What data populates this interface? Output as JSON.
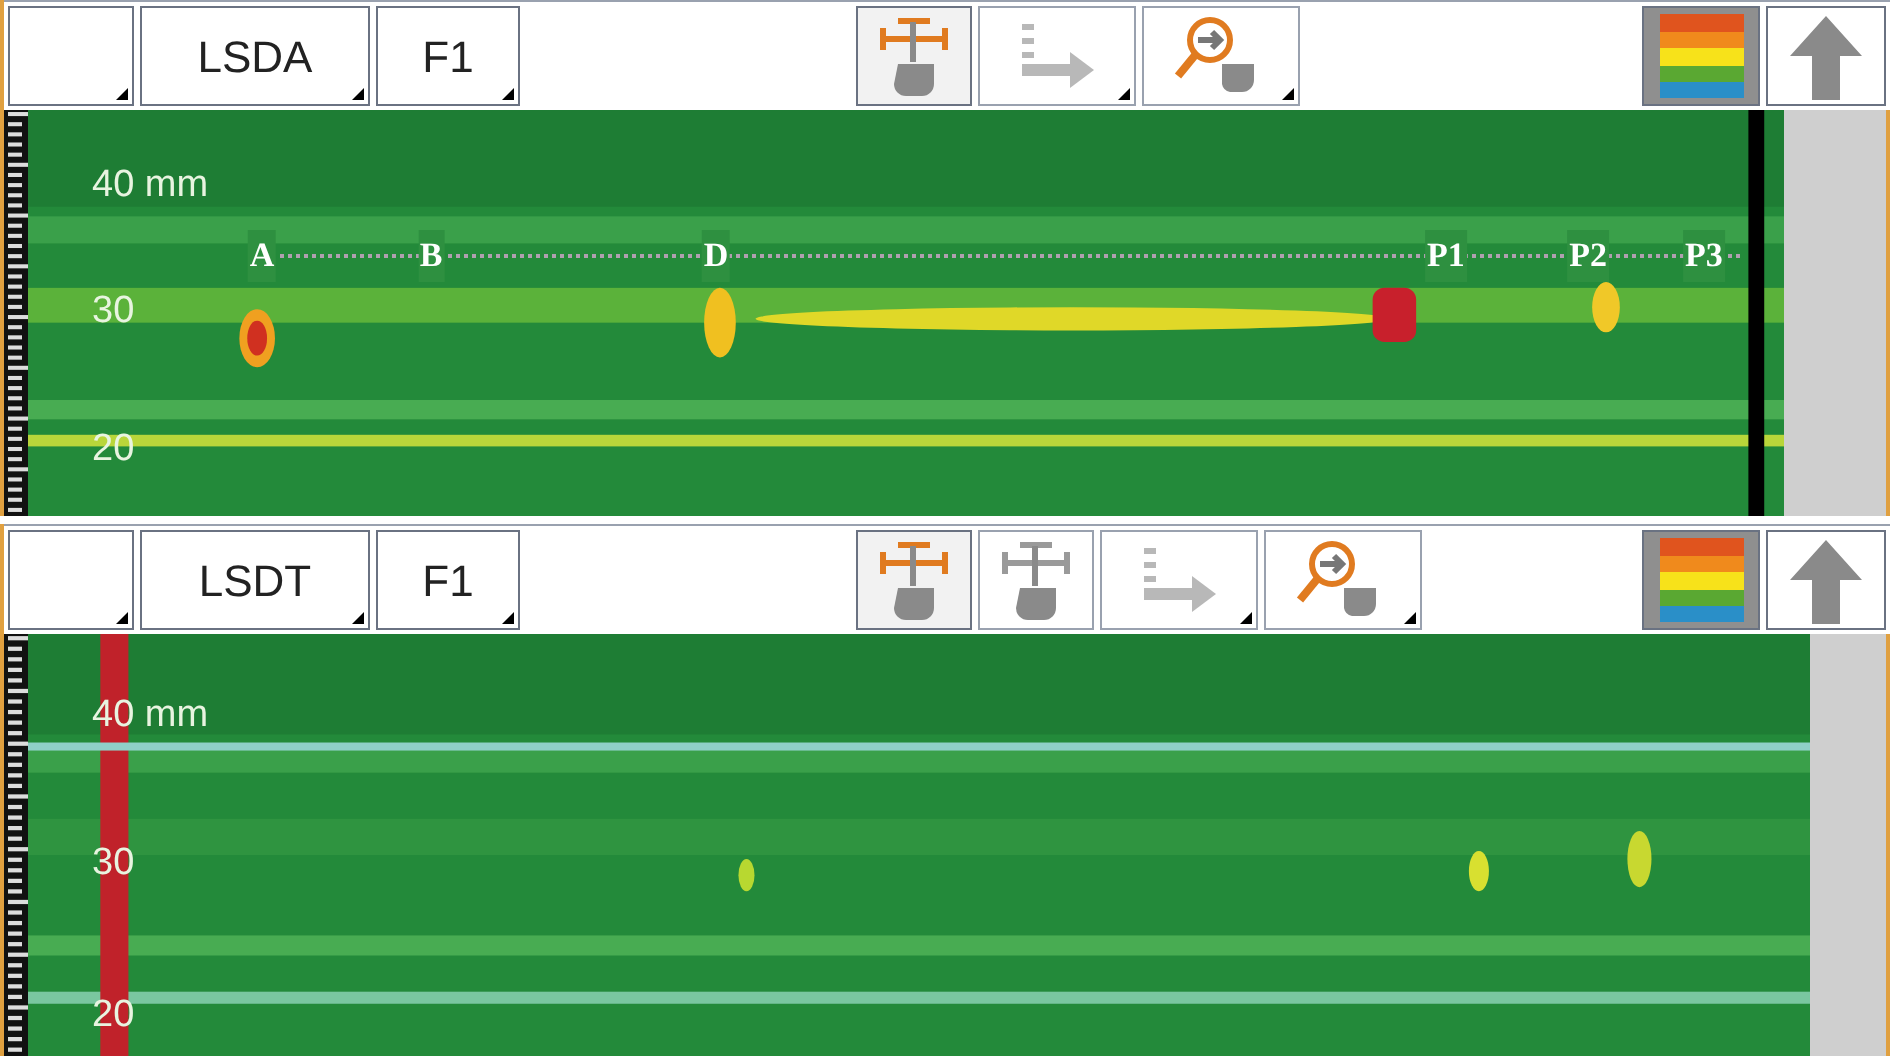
{
  "panels": [
    {
      "toolbar": {
        "channel": "LSDA",
        "filter": "F1",
        "tools": [
          {
            "kind": "gate",
            "active": true
          },
          {
            "kind": "axis",
            "active": false
          },
          {
            "kind": "zoom",
            "active": false
          }
        ]
      },
      "scale": [
        "40 mm",
        "30",
        "20"
      ],
      "markers": [
        "A",
        "B",
        "D",
        "P1",
        "P2",
        "P3"
      ]
    },
    {
      "toolbar": {
        "channel": "LSDT",
        "filter": "F1",
        "tools": [
          {
            "kind": "gate",
            "active": true
          },
          {
            "kind": "gate",
            "active": false
          },
          {
            "kind": "axis",
            "active": false
          },
          {
            "kind": "zoom",
            "active": false
          }
        ]
      },
      "scale": [
        "40 mm",
        "30",
        "20"
      ]
    }
  ]
}
